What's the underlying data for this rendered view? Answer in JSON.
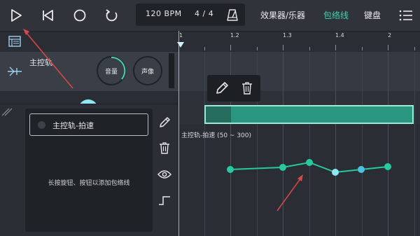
{
  "toolbar": {
    "tempo": "120 BPM",
    "time_signature": "4 / 4",
    "menu": [
      {
        "label": "效果器/乐器",
        "active": false
      },
      {
        "label": "包络线",
        "active": true
      },
      {
        "label": "键盘",
        "active": false
      }
    ]
  },
  "ruler": {
    "labels": [
      "1",
      "1.2",
      "1.3",
      "1.4",
      "2"
    ]
  },
  "track": {
    "name": "主控轨",
    "knobs": [
      {
        "label": "音量",
        "value": 0.35
      },
      {
        "label": "声像",
        "value": 0.5
      }
    ]
  },
  "automation": {
    "item_label": "主控轨-拍速",
    "hint": "长按旋钮、按钮以添加包络线",
    "lane_title": "主控轨-拍速 (50 ~ 300)"
  },
  "colors": {
    "accent": "#3fd3b0",
    "clip": "#2a9680",
    "point": "#26c9a0",
    "point_selected": "#8fe7f2",
    "playhead": "#4fd4e6",
    "annotation_arrow": "#d9474a"
  }
}
